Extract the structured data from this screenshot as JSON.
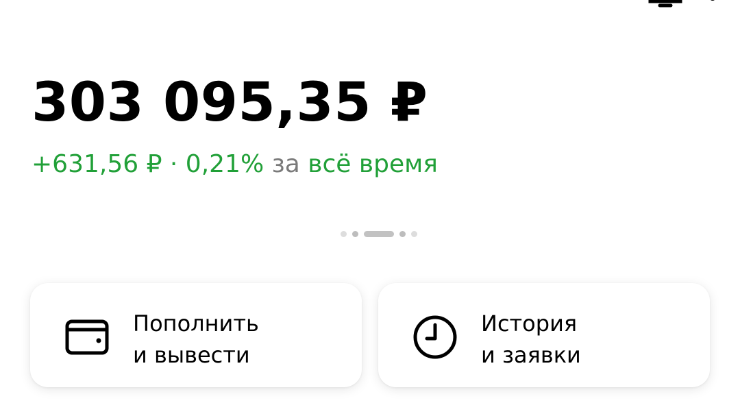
{
  "header": {
    "icons": [
      "partial-toolbar-icon",
      "partial-menu-icon"
    ]
  },
  "portfolio": {
    "balance": "303 095,35 ₽",
    "change_amount": "+631,56 ₽ · 0,21%",
    "change_period_prefix": "за",
    "change_period": "всё время"
  },
  "pager": {
    "pages": 5,
    "active_index": 2
  },
  "actions": [
    {
      "line1": "Пополнить",
      "line2": "и вывести",
      "icon": "wallet-icon"
    },
    {
      "line1": "История",
      "line2": "и заявки",
      "icon": "clock-icon"
    }
  ],
  "colors": {
    "positive": "#21a038",
    "muted": "#7a7a7a",
    "text": "#000000"
  }
}
